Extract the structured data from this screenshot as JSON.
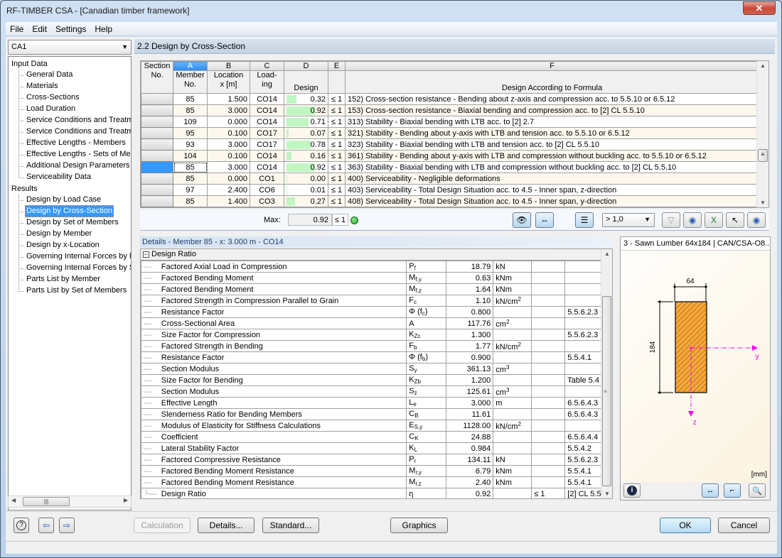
{
  "window": {
    "title": "RF-TIMBER CSA - [Canadian timber framework]",
    "close_icon": "close-icon"
  },
  "menu": [
    "File",
    "Edit",
    "Settings",
    "Help"
  ],
  "case_selector": {
    "value": "CA1"
  },
  "nav": {
    "input_group": "Input Data",
    "input_items": [
      "General Data",
      "Materials",
      "Cross-Sections",
      "Load Duration",
      "Service Conditions and Treatme",
      "Service Conditions and Treatme",
      "Effective Lengths - Members",
      "Effective Lengths - Sets of Mer",
      "Additional Design Parameters",
      "Serviceability Data"
    ],
    "results_group": "Results",
    "results_items": [
      "Design by Load Case",
      "Design by Cross-Section",
      "Design by Set of Members",
      "Design by Member",
      "Design by x-Location",
      "Governing Internal Forces by M",
      "Governing Internal Forces by S",
      "Parts List by Member",
      "Parts List by Set of Members"
    ],
    "selected": "Design by Cross-Section"
  },
  "section_title": "2.2  Design by Cross-Section",
  "grid": {
    "col_letters": [
      "A",
      "B",
      "C",
      "D",
      "E",
      "F"
    ],
    "headers": {
      "section_no": [
        "Section",
        "No."
      ],
      "member_no": [
        "Member",
        "No."
      ],
      "location": [
        "Location",
        "x [m]"
      ],
      "loading": [
        "Load-",
        "ing"
      ],
      "design": "Design",
      "formula": "Design According to Formula"
    },
    "rows": [
      {
        "member": "85",
        "x": "1.500",
        "loading": "CO14",
        "design": "0.32",
        "ratio": 0.32,
        "le": "≤ 1",
        "formula": "152) Cross-section resistance - Bending about z-axis and compression acc. to 5.5.10 or 6.5.12"
      },
      {
        "member": "85",
        "x": "3.000",
        "loading": "CO14",
        "design": "0.92",
        "ratio": 0.92,
        "le": "≤ 1",
        "formula": "153) Cross-section resistance - Biaxial bending and compression acc. to [2] CL 5.5.10"
      },
      {
        "member": "109",
        "x": "0.000",
        "loading": "CO14",
        "design": "0.71",
        "ratio": 0.71,
        "le": "≤ 1",
        "formula": "313) Stability - Biaxial bending with LTB acc. to [2] 2.7"
      },
      {
        "member": "95",
        "x": "0.100",
        "loading": "CO17",
        "design": "0.07",
        "ratio": 0.07,
        "le": "≤ 1",
        "formula": "321) Stability - Bending about y-axis with LTB and tension acc. to 5.5.10 or 6.5.12"
      },
      {
        "member": "93",
        "x": "3.000",
        "loading": "CO17",
        "design": "0.78",
        "ratio": 0.78,
        "le": "≤ 1",
        "formula": "323) Stability - Biaxial bending with LTB and tension acc. to [2] CL 5.5.10"
      },
      {
        "member": "104",
        "x": "0.100",
        "loading": "CO14",
        "design": "0.16",
        "ratio": 0.16,
        "le": "≤ 1",
        "formula": "361) Stability - Bending about y-axis with LTB and compression without buckling acc. to 5.5.10 or 6.5.12"
      },
      {
        "member": "85",
        "x": "3.000",
        "loading": "CO14",
        "design": "0.92",
        "ratio": 0.92,
        "le": "≤ 1",
        "formula": "363) Stability - Biaxial bending with LTB and compression without buckling acc. to [2] CL 5.5.10"
      },
      {
        "member": "85",
        "x": "0.000",
        "loading": "CO1",
        "design": "0.00",
        "ratio": 0.0,
        "le": "≤ 1",
        "formula": "400) Serviceability - Negligible deformations"
      },
      {
        "member": "97",
        "x": "2.400",
        "loading": "CO6",
        "design": "0.01",
        "ratio": 0.01,
        "le": "≤ 1",
        "formula": "403) Serviceability - Total Design Situation acc. to 4.5 - Inner span, z-direction"
      },
      {
        "member": "85",
        "x": "1.400",
        "loading": "CO3",
        "design": "0.27",
        "ratio": 0.27,
        "le": "≤ 1",
        "formula": "408) Serviceability - Total Design Situation acc. to 4.5 - Inner span, y-direction"
      }
    ],
    "selected_row": 6,
    "bar_color": "#c1f5c1"
  },
  "max": {
    "label": "Max:",
    "value": "0.92",
    "le": "≤ 1",
    "status_icon": "smiley-ok-icon"
  },
  "toolbar": {
    "filter_value": "> 1,0"
  },
  "details": {
    "title": "Details - Member 85 - x: 3.000 m - CO14",
    "group": "Design Ratio",
    "rows": [
      {
        "desc": "Factored Axial Load in Compression",
        "sym": "P",
        "sub": "f",
        "val": "18.79",
        "unit": "kN",
        "unit_sup": "",
        "le": "",
        "ref": ""
      },
      {
        "desc": "Factored Bending Moment",
        "sym": "M",
        "sub": "f,y",
        "val": "0.63",
        "unit": "kNm",
        "unit_sup": "",
        "le": "",
        "ref": ""
      },
      {
        "desc": "Factored Bending Moment",
        "sym": "M",
        "sub": "f,z",
        "val": "1.64",
        "unit": "kNm",
        "unit_sup": "",
        "le": "",
        "ref": ""
      },
      {
        "desc": "Factored Strength in Compression Parallel to Grain",
        "sym": "F",
        "sub": "c",
        "val": "1.10",
        "unit": "kN/cm",
        "unit_sup": "2",
        "le": "",
        "ref": ""
      },
      {
        "desc": "Resistance Factor",
        "sym": "Φ (f",
        "sub": "c",
        "sym_end": ")",
        "val": "0.800",
        "unit": "",
        "unit_sup": "",
        "le": "",
        "ref": "5.5.6.2.3"
      },
      {
        "desc": "Cross-Sectional Area",
        "sym": "A",
        "sub": "",
        "val": "117.76",
        "unit": "cm",
        "unit_sup": "2",
        "le": "",
        "ref": ""
      },
      {
        "desc": "Size Factor for Compression",
        "sym": "K",
        "sub": "Zc",
        "val": "1.300",
        "unit": "",
        "unit_sup": "",
        "le": "",
        "ref": "5.5.6.2.3"
      },
      {
        "desc": "Factored Strength in Bending",
        "sym": "F",
        "sub": "b",
        "val": "1.77",
        "unit": "kN/cm",
        "unit_sup": "2",
        "le": "",
        "ref": ""
      },
      {
        "desc": "Resistance Factor",
        "sym": "Φ (f",
        "sub": "b",
        "sym_end": ")",
        "val": "0.900",
        "unit": "",
        "unit_sup": "",
        "le": "",
        "ref": "5.5.4.1"
      },
      {
        "desc": "Section Modulus",
        "sym": "S",
        "sub": "y",
        "val": "361.13",
        "unit": "cm",
        "unit_sup": "3",
        "le": "",
        "ref": ""
      },
      {
        "desc": "Size Factor for Bending",
        "sym": "K",
        "sub": "Zb",
        "val": "1.200",
        "unit": "",
        "unit_sup": "",
        "le": "",
        "ref": "Table 5.4"
      },
      {
        "desc": "Section Modulus",
        "sym": "S",
        "sub": "z",
        "val": "125.61",
        "unit": "cm",
        "unit_sup": "3",
        "le": "",
        "ref": ""
      },
      {
        "desc": "Effective Length",
        "sym": "L",
        "sub": "e",
        "val": "3.000",
        "unit": "m",
        "unit_sup": "",
        "le": "",
        "ref": "6.5.6.4.3"
      },
      {
        "desc": "Slenderness Ratio for Bending Members",
        "sym": "C",
        "sub": "B",
        "val": "11.61",
        "unit": "",
        "unit_sup": "",
        "le": "",
        "ref": "6.5.6.4.3"
      },
      {
        "desc": "Modulus of Elasticity for Stiffness Calculations",
        "sym": "E",
        "sub": "S,y",
        "val": "1128.00",
        "unit": "kN/cm",
        "unit_sup": "2",
        "le": "",
        "ref": ""
      },
      {
        "desc": "Coefficient",
        "sym": "C",
        "sub": "K",
        "val": "24.88",
        "unit": "",
        "unit_sup": "",
        "le": "",
        "ref": "6.5.6.4.4"
      },
      {
        "desc": "Lateral Stability Factor",
        "sym": "K",
        "sub": "L",
        "val": "0.984",
        "unit": "",
        "unit_sup": "",
        "le": "",
        "ref": "5.5.4.2"
      },
      {
        "desc": "Factored Compressive Resistance",
        "sym": "P",
        "sub": "r",
        "val": "134.11",
        "unit": "kN",
        "unit_sup": "",
        "le": "",
        "ref": "5.5.6.2.3"
      },
      {
        "desc": "Factored Bending Moment Resistance",
        "sym": "M",
        "sub": "r,y",
        "val": "6.79",
        "unit": "kNm",
        "unit_sup": "",
        "le": "",
        "ref": "5.5.4.1"
      },
      {
        "desc": "Factored Bending Moment Resistance",
        "sym": "M",
        "sub": "r,z",
        "val": "2.40",
        "unit": "kNm",
        "unit_sup": "",
        "le": "",
        "ref": "5.5.4.1"
      },
      {
        "desc": "Design Ratio",
        "sym": "η",
        "sub": "",
        "val": "0.92",
        "unit": "",
        "unit_sup": "",
        "le": "≤ 1",
        "ref": "[2] CL 5.5"
      }
    ]
  },
  "graphic": {
    "title": "3 - Sawn Lumber 64x184 | CAN/CSA-O8...",
    "width_dim": "64",
    "height_dim": "184",
    "axis_y": "y",
    "axis_z": "z",
    "unit": "[mm]",
    "fill_color": "#e8921e",
    "axis_color": "#ff00ff"
  },
  "buttons": {
    "calculation": "Calculation",
    "details": "Details...",
    "standard": "Standard...",
    "graphics": "Graphics",
    "ok": "OK",
    "cancel": "Cancel"
  }
}
